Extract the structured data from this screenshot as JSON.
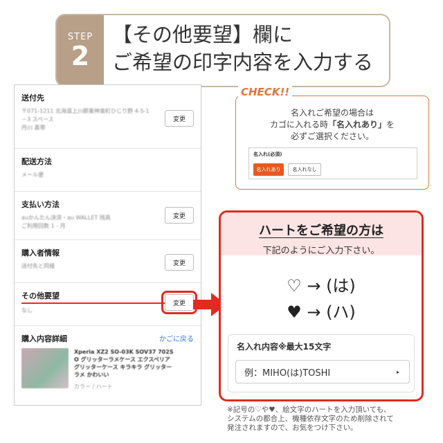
{
  "step": {
    "label": "STEP",
    "number": "2",
    "title_line1": "【その他要望】欄に",
    "title_line2": "ご希望の印字内容を入力する"
  },
  "phone": {
    "sections": [
      {
        "label": "送付先",
        "lines": [
          "〒071-1211 北海道上川郡東神楽町ひじり野 4-5-1",
          "－3 スペース",
          "丹川 喜帯"
        ],
        "button": "変更"
      },
      {
        "label": "配送方法",
        "lines": [
          "メール便"
        ],
        "button": ""
      },
      {
        "label": "支払い方法",
        "lines": [
          "auかんたん決済・au WALLET 残高",
          "ご利用回数 1 - 月"
        ],
        "button": "変更"
      },
      {
        "label": "購入者情報",
        "lines": [
          "送付先と同様"
        ],
        "button": "変更"
      },
      {
        "label": "その他要望",
        "lines": [
          "なし"
        ],
        "button": "変更"
      }
    ],
    "detail": {
      "label": "購入内容詳細",
      "back_link": "かごに戻る",
      "product_lines": [
        "Xperia XZ2 SO-03K SOV37 702S",
        "O グリッターラメケース エクスペリア",
        "グリッターケース キラキラ グリッター",
        "ラメ かわいい"
      ],
      "product_sub": "カラー / ハート"
    }
  },
  "check": {
    "tag": "CHECK!!",
    "line1": "名入れご希望の場合は",
    "line2_pre": "カゴに入れる時",
    "line2_bold": "「名入れあり」",
    "line2_post": "を",
    "line3": "必ずご選択ください。",
    "option_title": "名入れ(必須)",
    "option_on": "名入れあり",
    "option_off": "名入れなし"
  },
  "heart": {
    "title": "ハートをご希望の方は",
    "subtitle": "下記のようにご入力下さい。",
    "row1": "♡ → (は)",
    "row2": "♥ → (ハ)",
    "panel_title": "名入れ内容※最大15文字",
    "input_value": "例：MIHO(は)TOSHI",
    "caret": "▸"
  },
  "note": {
    "lines": [
      "※記号の♡や♥、絵文字のハートを入力頂いても、",
      "システムの都合上、機種依存文字のため削除されて",
      "発注されますので、お気をつけ下さい。"
    ]
  },
  "colors": {
    "accent_red": "#e12b1e",
    "accent_orange": "#e0763a",
    "step_brown": "#b79f88",
    "link_blue": "#3a7bd5"
  }
}
